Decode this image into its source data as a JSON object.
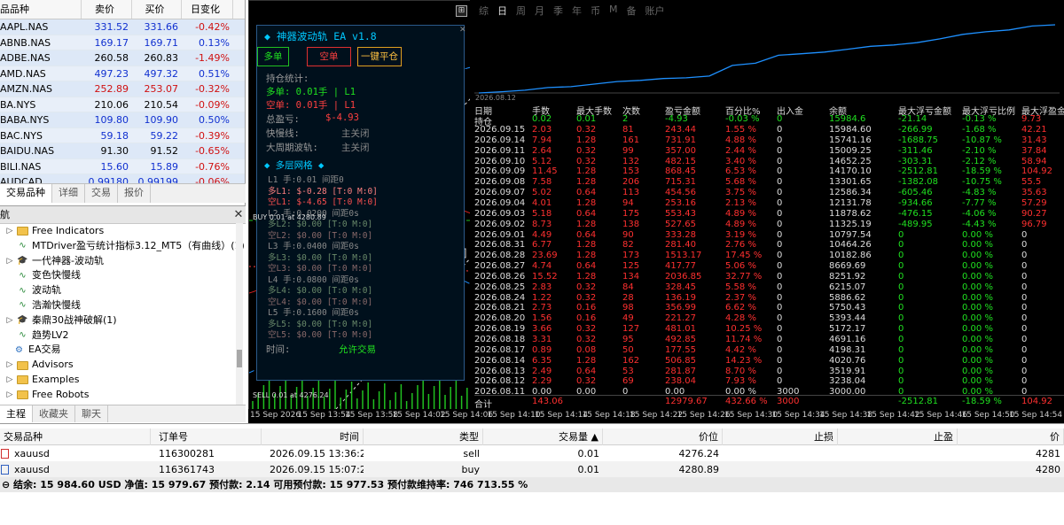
{
  "market_watch": {
    "headers": [
      "品品种",
      "卖价",
      "买价",
      "日变化"
    ],
    "rows": [
      {
        "symbol": "AAPL.NAS",
        "bid": "331.52",
        "ask": "331.66",
        "change": "-0.42%",
        "dir": "up"
      },
      {
        "symbol": "ABNB.NAS",
        "bid": "169.17",
        "ask": "169.71",
        "change": "0.13%",
        "dir": "up"
      },
      {
        "symbol": "ADBE.NAS",
        "bid": "260.58",
        "ask": "260.83",
        "change": "-1.49%",
        "dir": "nt"
      },
      {
        "symbol": "AMD.NAS",
        "bid": "497.23",
        "ask": "497.32",
        "change": "0.51%",
        "dir": "up"
      },
      {
        "symbol": "AMZN.NAS",
        "bid": "252.89",
        "ask": "253.07",
        "change": "-0.32%",
        "dir": "dn"
      },
      {
        "symbol": "BA.NYS",
        "bid": "210.06",
        "ask": "210.54",
        "change": "-0.09%",
        "dir": "nt"
      },
      {
        "symbol": "BABA.NYS",
        "bid": "109.80",
        "ask": "109.90",
        "change": "0.50%",
        "dir": "up"
      },
      {
        "symbol": "BAC.NYS",
        "bid": "59.18",
        "ask": "59.22",
        "change": "-0.39%",
        "dir": "up"
      },
      {
        "symbol": "BAIDU.NAS",
        "bid": "91.30",
        "ask": "91.52",
        "change": "-0.65%",
        "dir": "nt"
      },
      {
        "symbol": "BILI.NAS",
        "bid": "15.60",
        "ask": "15.89",
        "change": "-0.76%",
        "dir": "up"
      },
      {
        "symbol": "AUDCAD",
        "bid": "0.99180",
        "ask": "0.99199",
        "change": "-0.06%",
        "dir": "up"
      }
    ],
    "tabs": [
      "交易品种",
      "详细",
      "交易",
      "报价"
    ]
  },
  "navigator": {
    "title": "航",
    "items": [
      {
        "label": "Free Indicators",
        "type": "folder",
        "indent": 1,
        "arrow": "▷"
      },
      {
        "label": "MTDriver盈亏统计指标3.12_MT5（有曲线）(1)",
        "type": "ind",
        "indent": 1,
        "arrow": ""
      },
      {
        "label": "一代神器-波动轨",
        "type": "cap",
        "indent": 1,
        "arrow": "▷"
      },
      {
        "label": "变色快慢线",
        "type": "ind",
        "indent": 1,
        "arrow": ""
      },
      {
        "label": "波动轨",
        "type": "ind",
        "indent": 1,
        "arrow": ""
      },
      {
        "label": "浩瀚快慢线",
        "type": "ind",
        "indent": 1,
        "arrow": ""
      },
      {
        "label": "秦鼎30战神破解(1)",
        "type": "cap",
        "indent": 1,
        "arrow": "▷"
      },
      {
        "label": "趋势LV2",
        "type": "ind",
        "indent": 1,
        "arrow": ""
      },
      {
        "label": "EA交易",
        "type": "ea",
        "indent": 0,
        "arrow": ""
      },
      {
        "label": "Advisors",
        "type": "folder",
        "indent": 1,
        "arrow": "▷"
      },
      {
        "label": "Examples",
        "type": "folder",
        "indent": 1,
        "arrow": "▷"
      },
      {
        "label": "Free Robots",
        "type": "folder",
        "indent": 1,
        "arrow": "▷"
      },
      {
        "label": "123123",
        "type": "folder",
        "indent": 1,
        "arrow": ""
      }
    ],
    "tabs": [
      "主程",
      "收藏夹",
      "聊天"
    ]
  },
  "ea": {
    "title": "◆ 神器波动轨 EA v1.8",
    "buy_btn": "多单",
    "sell_btn": "空单",
    "close_btn": "一键平仓",
    "stat_label": "持仓统计:",
    "long_line": "多单: 0.01手 | L1",
    "short_line": "空单: 0.01手 | L1",
    "total_label": "总盈亏:",
    "total_val": "$-4.93",
    "fast_label": "快慢线:",
    "fast_status": "主关闭",
    "big_label": "大周期波轨:",
    "big_status": "主关闭",
    "grid_title": "◆ 多层网格 ◆",
    "grid_lines": [
      "L1 手:0.01 间距0",
      "多L1: $-0.28 [T:0 M:0]",
      "空L1: $-4.65 [T:0 M:0]",
      "L2 手:0.0200 间距0s",
      "多L2: $0.00 [T:0 M:0]",
      "空L2: $0.00 [T:0 M:0]",
      "L3 手:0.0400 间距0s",
      "多L3: $0.00 [T:0 M:0]",
      "空L3: $0.00 [T:0 M:0]",
      "L4 手:0.0800 间距0s",
      "多L4: $0.00 [T:0 M:0]",
      "空L4: $0.00 [T:0 M:0]",
      "L5 手:0.1600 间距0s",
      "多L5: $0.00 [T:0 M:0]",
      "空L5: $0.00 [T:0 M:0]"
    ],
    "time_label": "时间:",
    "time_status": "允许交易",
    "buy_marker": "BUY 0.01 at 4280.89",
    "sell_marker": "SELL 0.01 at 4276.24"
  },
  "report": {
    "tabs": [
      "综",
      "日",
      "周",
      "月",
      "季",
      "年",
      "币",
      "M",
      "备",
      "账户"
    ],
    "selected_tab": "日",
    "eq_date": "2026.08.12",
    "headers": [
      "日期",
      "手数",
      "最大手数",
      "次数",
      "盈亏金额",
      "百分比%",
      "出入金",
      "余额",
      "最大浮亏金额",
      "最大浮亏比例",
      "最大浮盈金"
    ],
    "hold": [
      "持仓",
      "0.02",
      "0.01",
      "2",
      "-4.93",
      "-0.03 %",
      "0",
      "15984.6",
      "-21.14",
      "-0.13 %",
      "9.73"
    ],
    "rows": [
      [
        "2026.09.15",
        "2.03",
        "0.32",
        "81",
        "243.44",
        "1.55 %",
        "0",
        "15984.60",
        "-266.99",
        "-1.68 %",
        "42.21"
      ],
      [
        "2026.09.14",
        "7.94",
        "1.28",
        "161",
        "731.91",
        "4.88 %",
        "0",
        "15741.16",
        "-1688.75",
        "-10.87 %",
        "31.43"
      ],
      [
        "2026.09.11",
        "2.64",
        "0.32",
        "99",
        "357.00",
        "2.44 %",
        "0",
        "15009.25",
        "-311.46",
        "-2.10 %",
        "37.84"
      ],
      [
        "2026.09.10",
        "5.12",
        "0.32",
        "132",
        "482.15",
        "3.40 %",
        "0",
        "14652.25",
        "-303.31",
        "-2.12 %",
        "58.94"
      ],
      [
        "2026.09.09",
        "11.45",
        "1.28",
        "153",
        "868.45",
        "6.53 %",
        "0",
        "14170.10",
        "-2512.81",
        "-18.59 %",
        "104.92"
      ],
      [
        "2026.09.08",
        "7.58",
        "1.28",
        "206",
        "715.31",
        "5.68 %",
        "0",
        "13301.65",
        "-1382.08",
        "-10.75 %",
        "55.5"
      ],
      [
        "2026.09.07",
        "5.02",
        "0.64",
        "113",
        "454.56",
        "3.75 %",
        "0",
        "12586.34",
        "-605.46",
        "-4.83 %",
        "35.63"
      ],
      [
        "2026.09.04",
        "4.01",
        "1.28",
        "94",
        "253.16",
        "2.13 %",
        "0",
        "12131.78",
        "-934.66",
        "-7.77 %",
        "57.29"
      ],
      [
        "2026.09.03",
        "5.18",
        "0.64",
        "175",
        "553.43",
        "4.89 %",
        "0",
        "11878.62",
        "-476.15",
        "-4.06 %",
        "90.27"
      ],
      [
        "2026.09.02",
        "8.73",
        "1.28",
        "138",
        "527.65",
        "4.89 %",
        "0",
        "11325.19",
        "-489.95",
        "-4.43 %",
        "96.79"
      ],
      [
        "2026.09.01",
        "4.49",
        "0.64",
        "90",
        "333.28",
        "3.19 %",
        "0",
        "10797.54",
        "0",
        "0.00 %",
        "0"
      ],
      [
        "2026.08.31",
        "6.77",
        "1.28",
        "82",
        "281.40",
        "2.76 %",
        "0",
        "10464.26",
        "0",
        "0.00 %",
        "0"
      ],
      [
        "2026.08.28",
        "23.69",
        "1.28",
        "173",
        "1513.17",
        "17.45 %",
        "0",
        "10182.86",
        "0",
        "0.00 %",
        "0"
      ],
      [
        "2026.08.27",
        "4.74",
        "0.64",
        "125",
        "417.77",
        "5.06 %",
        "0",
        "8669.69",
        "0",
        "0.00 %",
        "0"
      ],
      [
        "2026.08.26",
        "15.52",
        "1.28",
        "134",
        "2036.85",
        "32.77 %",
        "0",
        "8251.92",
        "0",
        "0.00 %",
        "0"
      ],
      [
        "2026.08.25",
        "2.83",
        "0.32",
        "84",
        "328.45",
        "5.58 %",
        "0",
        "6215.07",
        "0",
        "0.00 %",
        "0"
      ],
      [
        "2026.08.24",
        "1.22",
        "0.32",
        "28",
        "136.19",
        "2.37 %",
        "0",
        "5886.62",
        "0",
        "0.00 %",
        "0"
      ],
      [
        "2026.08.21",
        "2.73",
        "0.16",
        "98",
        "356.99",
        "6.62 %",
        "0",
        "5750.43",
        "0",
        "0.00 %",
        "0"
      ],
      [
        "2026.08.20",
        "1.56",
        "0.16",
        "49",
        "221.27",
        "4.28 %",
        "0",
        "5393.44",
        "0",
        "0.00 %",
        "0"
      ],
      [
        "2026.08.19",
        "3.66",
        "0.32",
        "127",
        "481.01",
        "10.25 %",
        "0",
        "5172.17",
        "0",
        "0.00 %",
        "0"
      ],
      [
        "2026.08.18",
        "3.31",
        "0.32",
        "95",
        "492.85",
        "11.74 %",
        "0",
        "4691.16",
        "0",
        "0.00 %",
        "0"
      ],
      [
        "2026.08.17",
        "0.89",
        "0.08",
        "50",
        "177.55",
        "4.42 %",
        "0",
        "4198.31",
        "0",
        "0.00 %",
        "0"
      ],
      [
        "2026.08.14",
        "6.35",
        "1.28",
        "162",
        "506.85",
        "14.23 %",
        "0",
        "4020.76",
        "0",
        "0.00 %",
        "0"
      ],
      [
        "2026.08.13",
        "2.49",
        "0.64",
        "53",
        "281.87",
        "8.70 %",
        "0",
        "3519.91",
        "0",
        "0.00 %",
        "0"
      ],
      [
        "2026.08.12",
        "2.29",
        "0.32",
        "69",
        "238.04",
        "7.93 %",
        "0",
        "3238.04",
        "0",
        "0.00 %",
        "0"
      ],
      [
        "2026.08.11",
        "0.00",
        "0.00",
        "0",
        "0.00",
        "0.00 %",
        "3000",
        "3000.00",
        "0",
        "0.00 %",
        "0"
      ]
    ],
    "total": [
      "合计",
      "143.06",
      "",
      "",
      "12979.67",
      "432.66 %",
      "3000",
      "",
      "-2512.81",
      "-18.59 %",
      "104.92"
    ]
  },
  "axis_labels": [
    "15 Sep 2026",
    "15 Sep 13:54",
    "15 Sep 13:58",
    "15 Sep 14:02",
    "15 Sep 14:06",
    "15 Sep 14:10",
    "15 Sep 14:14",
    "15 Sep 14:18",
    "15 Sep 14:22",
    "15 Sep 14:26",
    "15 Sep 14:30",
    "15 Sep 14:34",
    "15 Sep 14:38",
    "15 Sep 14:42",
    "15 Sep 14:46",
    "15 Sep 14:50",
    "15 Sep 14:54"
  ],
  "trade": {
    "headers": [
      "交易品种",
      "订单号",
      "时间",
      "类型",
      "交易量 ▲",
      "价位",
      "止损",
      "止盈",
      "价"
    ],
    "rows": [
      [
        "xauusd",
        "116300281",
        "2026.09.15 13:36:21",
        "sell",
        "0.01",
        "4276.24",
        "",
        "",
        "4281"
      ],
      [
        "xauusd",
        "116361743",
        "2026.09.15 15:07:24",
        "buy",
        "0.01",
        "4280.89",
        "",
        "",
        "4280"
      ]
    ],
    "summary": "⊖ 结余: 15 984.60 USD  净值: 15 979.67  预付款: 2.14  可用预付款: 15 977.53  预付款维持率: 746 713.55 %"
  },
  "colors": {
    "up": "#1030d0",
    "down": "#d01010",
    "red": "#ff3030",
    "green": "#20e020",
    "cyan": "#00c8ff"
  }
}
